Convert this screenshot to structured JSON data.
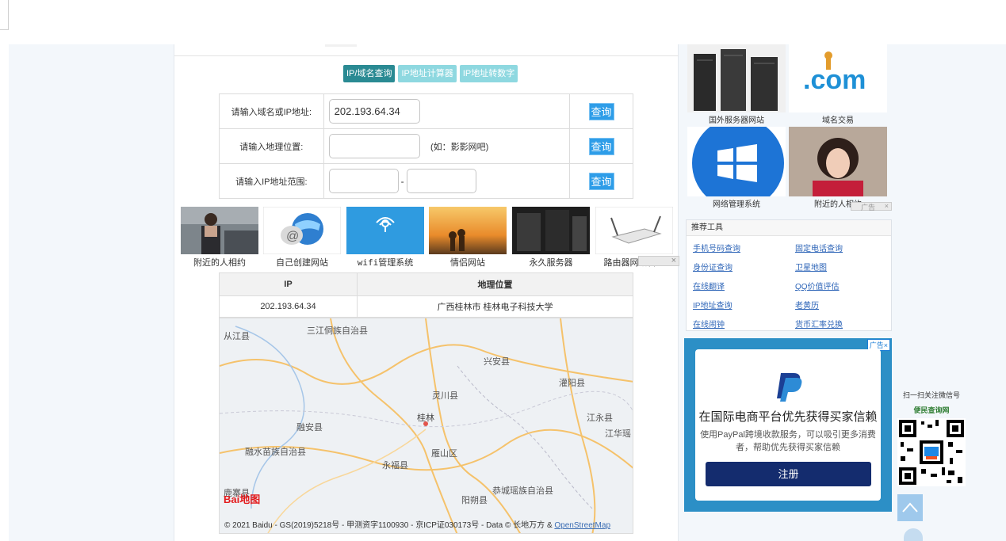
{
  "tabs": [
    "IP/域名查询",
    "IP地址计算器",
    "IP地址转数字"
  ],
  "form": {
    "row1": {
      "label": "请输入域名或IP地址:",
      "value": "202.193.64.34",
      "button": "查询"
    },
    "row2": {
      "label": "请输入地理位置:",
      "hint": "(如：影影网吧)",
      "button": "查询"
    },
    "row3": {
      "label": "请输入IP地址范围:",
      "sep": "-",
      "button": "查询"
    }
  },
  "strip": [
    {
      "caption": "附近的人相约"
    },
    {
      "caption": "自己创建网站"
    },
    {
      "caption": "wifi管理系统"
    },
    {
      "caption": "情侣网站"
    },
    {
      "caption": "永久服务器"
    },
    {
      "caption": "路由器网络管理"
    }
  ],
  "strip_ad_close": "×",
  "result": {
    "headers": [
      "IP",
      "地理位置"
    ],
    "ip": "202.193.64.34",
    "location": "广西桂林市 桂林电子科技大学"
  },
  "map": {
    "places": [
      "从江县",
      "三江侗族自治县",
      "兴安县",
      "灌阳县",
      "灵川县",
      "桂林",
      "江永县",
      "江华瑶",
      "融安县",
      "融水苗族自治县",
      "永福县",
      "雁山区",
      "恭城瑶族自治县",
      "阳朔县",
      "鹿寨县"
    ],
    "logo": "Bai地图",
    "copyright": "© 2021 Baidu - GS(2019)5218号 - 甲测资字1100930 - 京ICP证030173号 - Data © 长地万方 & ",
    "osm": "OpenStreetMap"
  },
  "right_pics": [
    {
      "caption": "国外服务器网站"
    },
    {
      "caption": "域名交易"
    },
    {
      "caption": "网络管理系统"
    },
    {
      "caption": "附近的人相约"
    }
  ],
  "ad_small": {
    "label": "广告",
    "close": "×"
  },
  "tools": {
    "title": "推荐工具",
    "links": [
      "手机号码查询",
      "固定电话查询",
      "身份证查询",
      "卫星地图",
      "在线翻译",
      "QQ价值评估",
      "IP地址查询",
      "老黄历",
      "在线闹钟",
      "货币汇率兑换"
    ]
  },
  "paypal_ad": {
    "badge": "广告×",
    "title": "在国际电商平台优先获得买家信赖",
    "desc": "使用PayPal跨境收款服务，可以吸引更多消费者，帮助优先获得买家信赖",
    "button": "注册"
  },
  "wechat": {
    "text": "扫一扫关注微信号",
    "site": "便民查询网"
  },
  "colors": {
    "tab_active": "#2a8a93",
    "tab": "#8ed8e0",
    "query_button": "#2e9de8",
    "link": "#2f66b8",
    "paypal_bg": "#2c8fc6",
    "paypal_button": "#142c6e"
  }
}
